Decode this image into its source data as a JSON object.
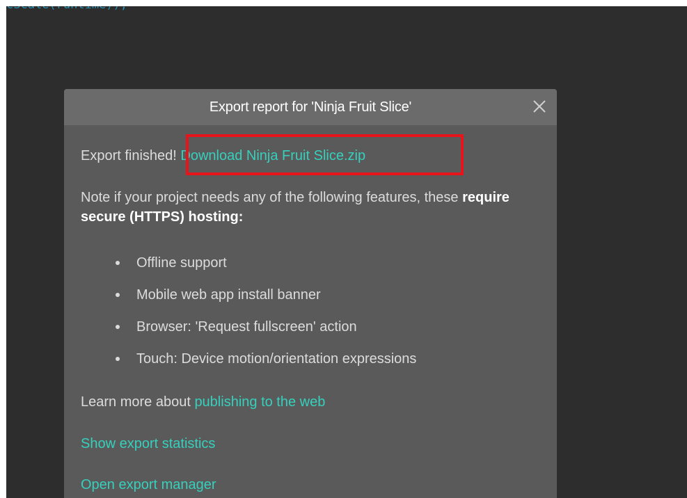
{
  "editor": {
    "code_fragment": "cScale(runtime));"
  },
  "dialog": {
    "title": "Export report for 'Ninja Fruit Slice'",
    "close_icon": "close-icon",
    "finished_prefix": "Export finished! ",
    "download_link": "Download Ninja Fruit Slice.zip",
    "note_text": "Note if your project needs any of the following features, these ",
    "note_bold": "require secure (HTTPS) hosting:",
    "features": [
      "Offline support",
      "Mobile web app install banner",
      "Browser: 'Request fullscreen' action",
      "Touch: Device motion/orientation expressions"
    ],
    "learn_more_prefix": "Learn more about ",
    "learn_more_link": "publishing to the web",
    "show_stats_link": "Show export statistics",
    "open_manager_link": "Open export manager"
  },
  "colors": {
    "link": "#36d0bd",
    "highlight": "#e8141b",
    "dialog_bg": "#5a5a5a",
    "header_bg": "#6b6b6b",
    "editor_bg": "#2d2d2d"
  }
}
